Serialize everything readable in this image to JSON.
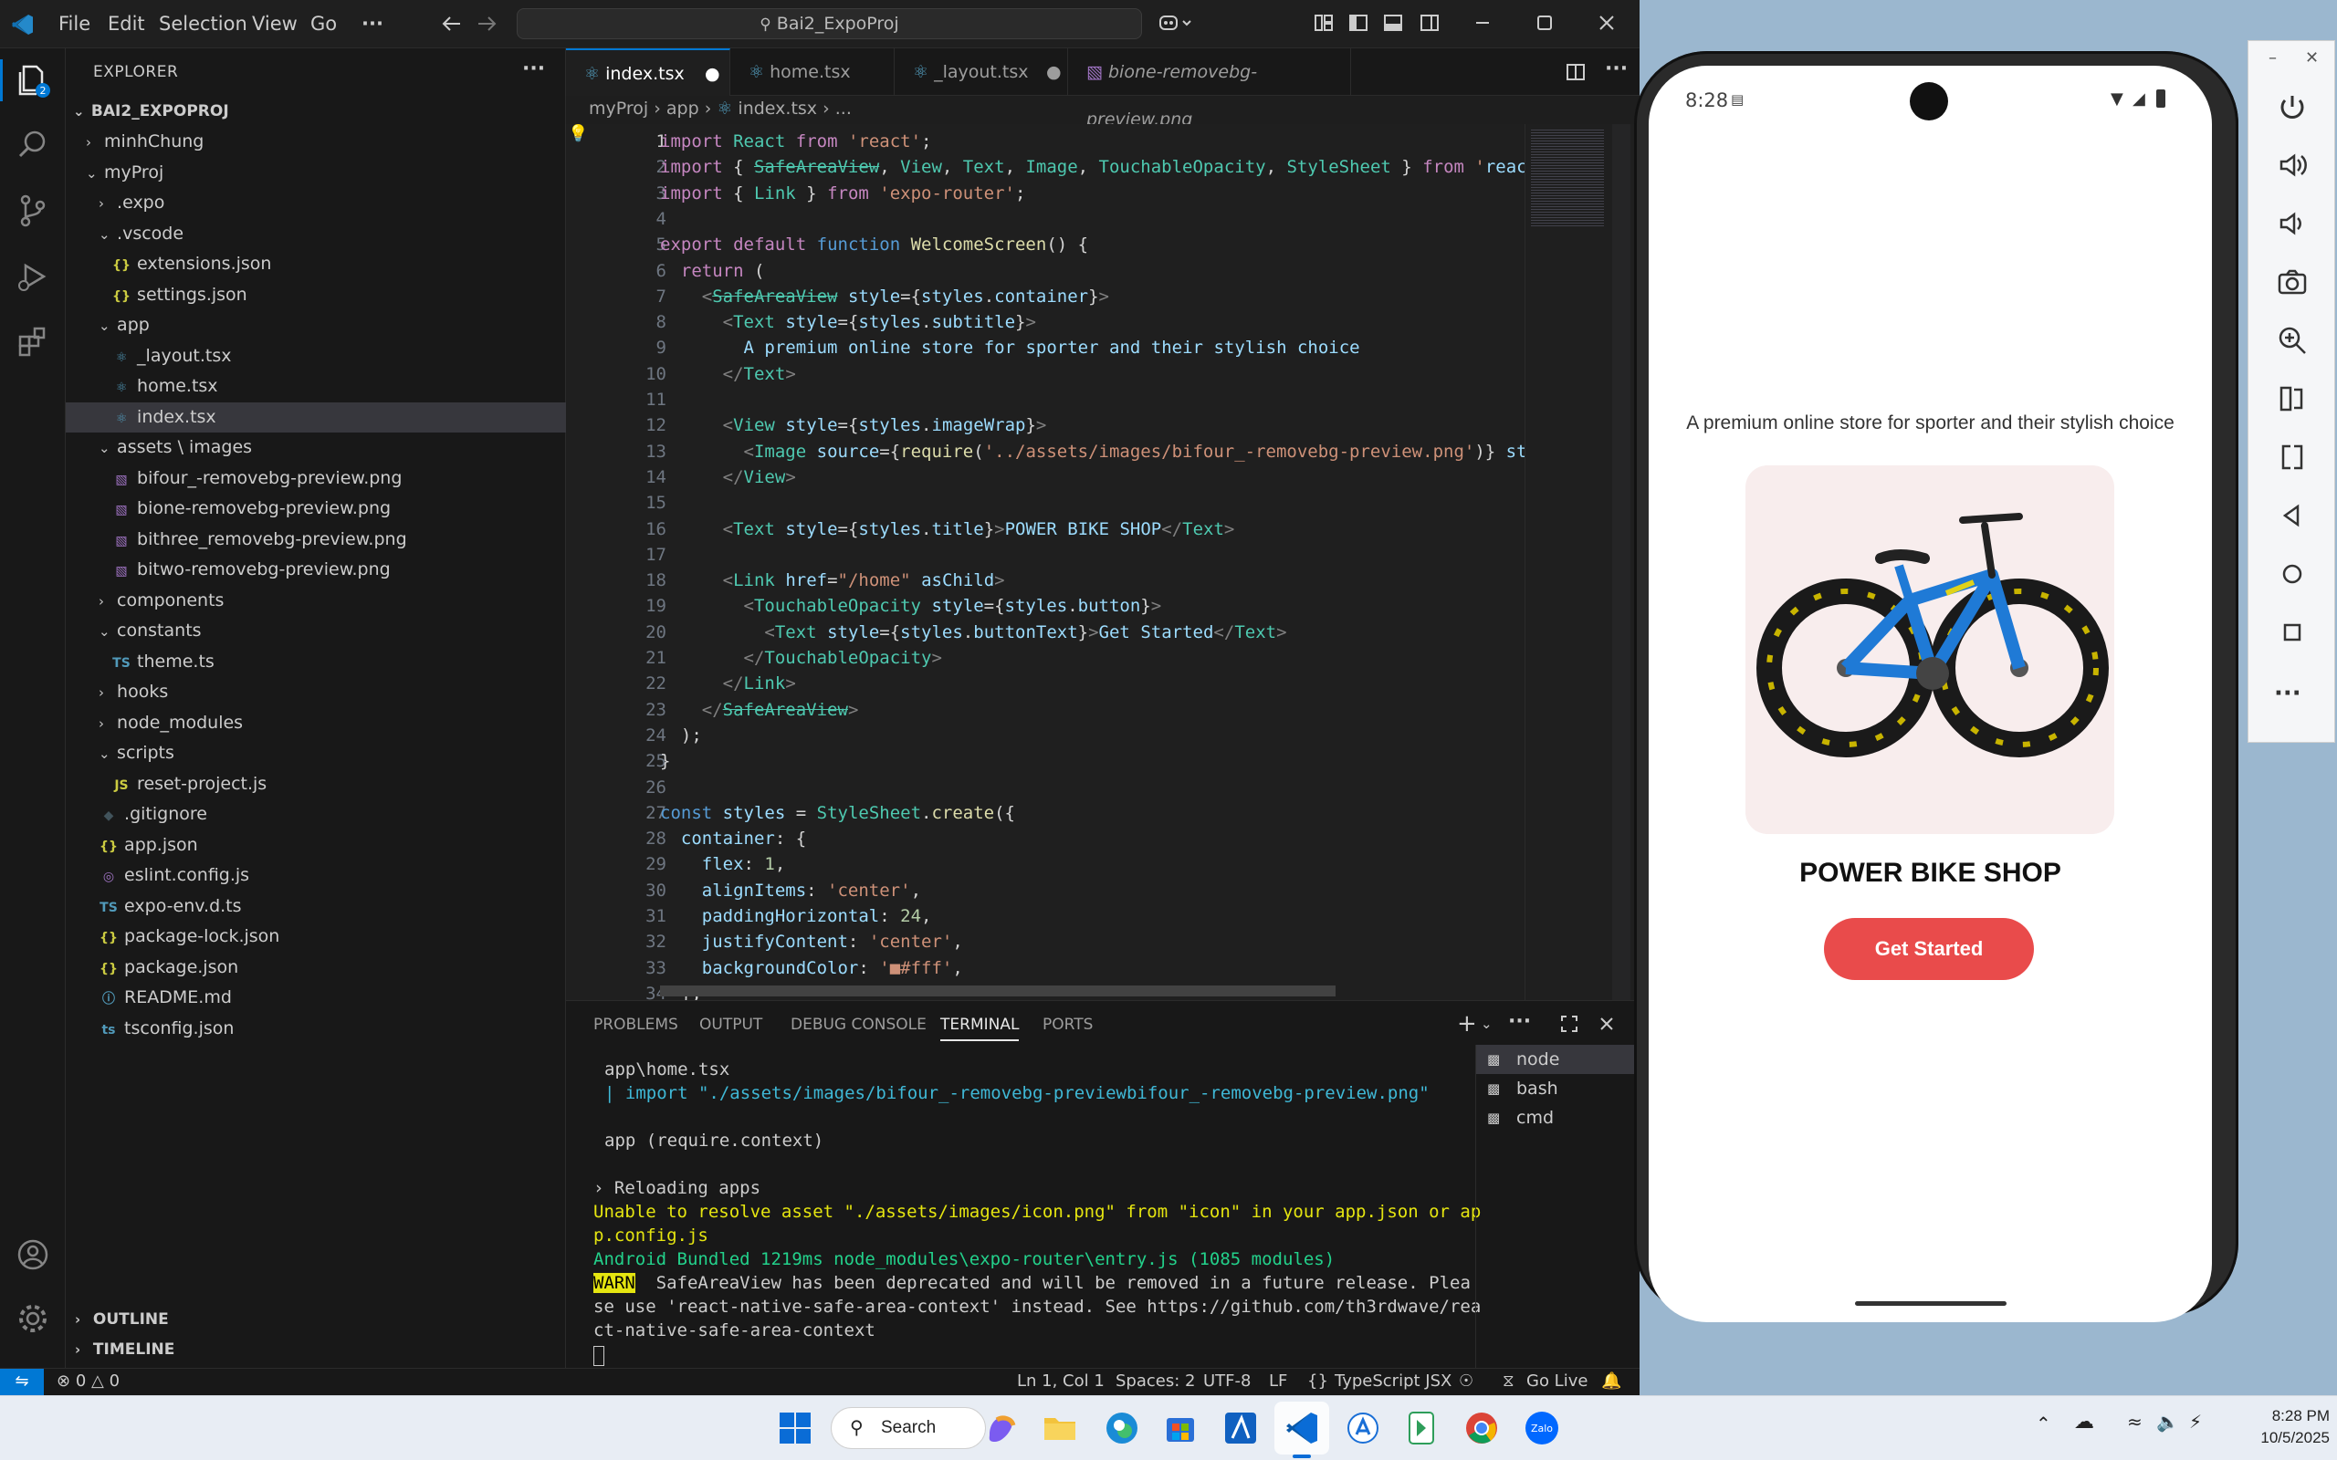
{
  "titlebar": {
    "menus": [
      "File",
      "Edit",
      "Selection",
      "View",
      "Go",
      "···"
    ],
    "search": "Bai2_ExpoProj"
  },
  "explorer": {
    "title": "EXPLORER",
    "root": "BAI2_EXPOPROJ",
    "items": [
      {
        "label": "minhChung",
        "depth": 1,
        "type": "folder",
        "open": false
      },
      {
        "label": "myProj",
        "depth": 1,
        "type": "folder",
        "open": true
      },
      {
        "label": ".expo",
        "depth": 2,
        "type": "folder",
        "open": false
      },
      {
        "label": ".vscode",
        "depth": 2,
        "type": "folder",
        "open": true
      },
      {
        "label": "extensions.json",
        "depth": 3,
        "type": "json"
      },
      {
        "label": "settings.json",
        "depth": 3,
        "type": "json"
      },
      {
        "label": "app",
        "depth": 2,
        "type": "folder",
        "open": true
      },
      {
        "label": "_layout.tsx",
        "depth": 3,
        "type": "react"
      },
      {
        "label": "home.tsx",
        "depth": 3,
        "type": "react"
      },
      {
        "label": "index.tsx",
        "depth": 3,
        "type": "react",
        "selected": true
      },
      {
        "label": "assets \\ images",
        "depth": 2,
        "type": "folder",
        "open": true
      },
      {
        "label": "bifour_-removebg-preview.png",
        "depth": 3,
        "type": "image"
      },
      {
        "label": "bione-removebg-preview.png",
        "depth": 3,
        "type": "image"
      },
      {
        "label": "bithree_removebg-preview.png",
        "depth": 3,
        "type": "image"
      },
      {
        "label": "bitwo-removebg-preview.png",
        "depth": 3,
        "type": "image"
      },
      {
        "label": "components",
        "depth": 2,
        "type": "folder",
        "open": false
      },
      {
        "label": "constants",
        "depth": 2,
        "type": "folder",
        "open": true
      },
      {
        "label": "theme.ts",
        "depth": 3,
        "type": "ts"
      },
      {
        "label": "hooks",
        "depth": 2,
        "type": "folder",
        "open": false
      },
      {
        "label": "node_modules",
        "depth": 2,
        "type": "folder",
        "open": false
      },
      {
        "label": "scripts",
        "depth": 2,
        "type": "folder",
        "open": true
      },
      {
        "label": "reset-project.js",
        "depth": 3,
        "type": "js"
      },
      {
        "label": ".gitignore",
        "depth": 2,
        "type": "git"
      },
      {
        "label": "app.json",
        "depth": 2,
        "type": "json"
      },
      {
        "label": "eslint.config.js",
        "depth": 2,
        "type": "eslint"
      },
      {
        "label": "expo-env.d.ts",
        "depth": 2,
        "type": "ts"
      },
      {
        "label": "package-lock.json",
        "depth": 2,
        "type": "json"
      },
      {
        "label": "package.json",
        "depth": 2,
        "type": "json"
      },
      {
        "label": "README.md",
        "depth": 2,
        "type": "info"
      },
      {
        "label": "tsconfig.json",
        "depth": 2,
        "type": "tsconfig"
      }
    ],
    "outline": "OUTLINE",
    "timeline": "TIMELINE"
  },
  "tabs": [
    {
      "label": "index.tsx",
      "active": true,
      "dirty": true
    },
    {
      "label": "home.tsx",
      "active": false,
      "dirty": false
    },
    {
      "label": "_layout.tsx",
      "active": false,
      "dirty": true
    },
    {
      "label": "bione-removebg-preview.png",
      "active": false,
      "dirty": false
    }
  ],
  "breadcrumb": [
    "myProj",
    "app",
    "index.tsx",
    "..."
  ],
  "code_lines": [
    "import React from 'react';",
    "import { SafeAreaView, View, Text, Image, TouchableOpacity, StyleSheet } from 'reac",
    "import { Link } from 'expo-router';",
    "",
    "export default function WelcomeScreen() {",
    "  return (",
    "    <SafeAreaView style={styles.container}>",
    "      <Text style={styles.subtitle}>",
    "        A premium online store for sporter and their stylish choice",
    "      </Text>",
    "",
    "      <View style={styles.imageWrap}>",
    "        <Image source={require('../assets/images/bifour_-removebg-preview.png')} st",
    "      </View>",
    "",
    "      <Text style={styles.title}>POWER BIKE SHOP</Text>",
    "",
    "      <Link href=\"/home\" asChild>",
    "        <TouchableOpacity style={styles.button}>",
    "          <Text style={styles.buttonText}>Get Started</Text>",
    "        </TouchableOpacity>",
    "      </Link>",
    "    </SafeAreaView>",
    "  );",
    "}",
    "",
    "const styles = StyleSheet.create({",
    "  container: {",
    "    flex: 1,",
    "    alignItems: 'center',",
    "    paddingHorizontal: 24,",
    "    justifyContent: 'center',",
    "    backgroundColor: '■#fff',",
    "  },"
  ],
  "panel": {
    "tabs": [
      "PROBLEMS",
      "OUTPUT",
      "DEBUG CONSOLE",
      "TERMINAL",
      "PORTS"
    ],
    "active_tab": "TERMINAL",
    "terminal_lines": [
      "app\\home.tsx",
      "| import \"./assets/images/bifour_-removebg-previewbifour_-removebg-preview.png\"",
      "",
      "app (require.context)",
      "",
      "› Reloading apps",
      "Unable to resolve asset \"./assets/images/icon.png\" from \"icon\" in your app.json or ap",
      "p.config.js",
      "Android Bundled 1219ms node_modules\\expo-router\\entry.js (1085 modules)",
      "WARN  SafeAreaView has been deprecated and will be removed in a future release. Plea",
      "se use 'react-native-safe-area-context' instead. See https://github.com/th3rdwave/rea",
      "ct-native-safe-area-context"
    ],
    "terminals": [
      "node",
      "bash",
      "cmd"
    ]
  },
  "statusbar": {
    "errors": "0",
    "warnings": "0",
    "position": "Ln 1, Col 1",
    "spaces": "Spaces: 2",
    "encoding": "UTF-8",
    "eol": "LF",
    "language": "TypeScript JSX",
    "golive": "Go Live"
  },
  "phone": {
    "time": "8:28",
    "subtitle": "A premium online store for sporter and their stylish choice",
    "title": "POWER BIKE SHOP",
    "button": "Get Started",
    "accent": "#e94b4b"
  },
  "taskbar": {
    "search": "Search",
    "time": "8:28 PM",
    "date": "10/5/2025"
  },
  "colors": {
    "vscode_accent": "#0078d4",
    "warn_bg": "#e5e510"
  }
}
